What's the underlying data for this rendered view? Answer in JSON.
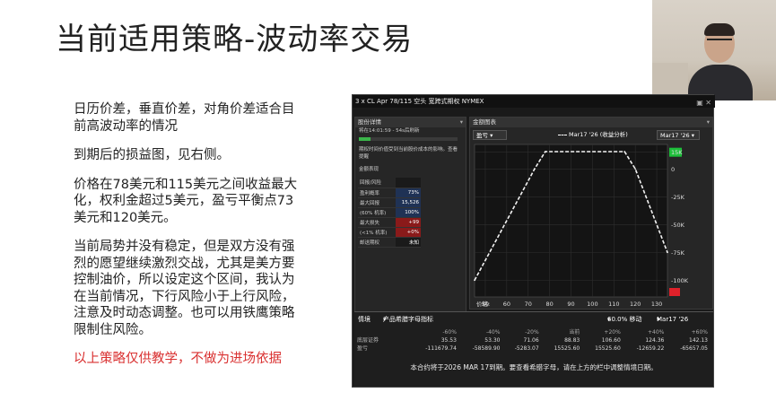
{
  "slide": {
    "title": "当前适用策略-波动率交易",
    "paragraphs": [
      "日历价差，垂直价差，对角价差适合目前高波动率的情况",
      "到期后的损益图，见右侧。",
      "价格在78美元和115美元之间收益最大化，权利金超过5美元，盈亏平衡点73美元和120美元。",
      "当前局势并没有稳定，但是双方没有强烈的愿望继续激烈交战，尤其是美方要控制油价，所以设定这个区间，我认为在当前情况，下行风险小于上行风险，注意及时动态调整。也可以用铁鹰策略限制住风险。"
    ],
    "note": "以上策略仅供教学，不做为进场依据"
  },
  "tws": {
    "title": "3 x CL Apr 78/115 空头 宽跨式期权 NYMEX",
    "left_panel": {
      "header": "股份详情",
      "time_row": "将在14:01:59 - 54s后刷新",
      "progress": 0.12,
      "warning": "期权时间价值受到当前股价成本的影响。查看提醒",
      "table_header": "金额表现",
      "rows": [
        {
          "label": "回报/风险",
          "value": ""
        },
        {
          "label": "盈利概率",
          "value": "73%"
        },
        {
          "label": "最大回报",
          "value": "15,526"
        },
        {
          "label": "(60% 机率)",
          "value": "100%"
        },
        {
          "label": "最大损失",
          "value": "+99"
        },
        {
          "label": "(<1% 机率)",
          "value": "+0%"
        },
        {
          "label": "邮送期权",
          "value": "未知"
        }
      ]
    },
    "chart_panel": {
      "header": "金额图表",
      "dropdown_left": "盈亏",
      "legend": "Mar17 '26 (收益分析)",
      "dropdown_right": "Mar17 '26",
      "xaxis_prefix": "价格:"
    },
    "bottom": {
      "label": "情境",
      "indicator": "产品希腊字母指标",
      "vol_label": "60.0% 移动",
      "date_label": "Mar17 '26",
      "cols": [
        "-60%",
        "-40%",
        "-20%",
        "当前",
        "+20%",
        "+40%",
        "+60%"
      ],
      "rows": [
        {
          "label": "底层证券",
          "values": [
            "35.53",
            "53.30",
            "71.06",
            "88.83",
            "106.60",
            "124.36",
            "142.13"
          ]
        },
        {
          "label": "盈亏",
          "values": [
            "-111679.74",
            "-58589.90",
            "-5283.07",
            "15525.60",
            "15525.60",
            "-12659.22",
            "-65657.05"
          ]
        }
      ],
      "note": "本合约将于2026 MAR 17到期。要查看希腊字母，请在上方的栏中调整情境日期。"
    }
  },
  "chart_data": {
    "type": "line",
    "x": [
      45,
      73,
      78,
      115,
      120,
      135
    ],
    "series": [
      {
        "values": [
          -100000,
          0,
          15526,
          15526,
          0,
          -75000
        ]
      }
    ],
    "xticks": [
      50,
      60,
      70,
      80,
      90,
      100,
      110,
      120,
      130
    ],
    "yticks": [
      "15K",
      "0",
      "-25K",
      "-50K",
      "-75K",
      "-100K"
    ],
    "xlim": [
      45,
      135
    ],
    "ylim": [
      -115000,
      22000
    ],
    "grid": true
  },
  "colors": {
    "accent_green": "#1dbf3a",
    "accent_red": "#e0212a",
    "note_red": "#d93030"
  }
}
